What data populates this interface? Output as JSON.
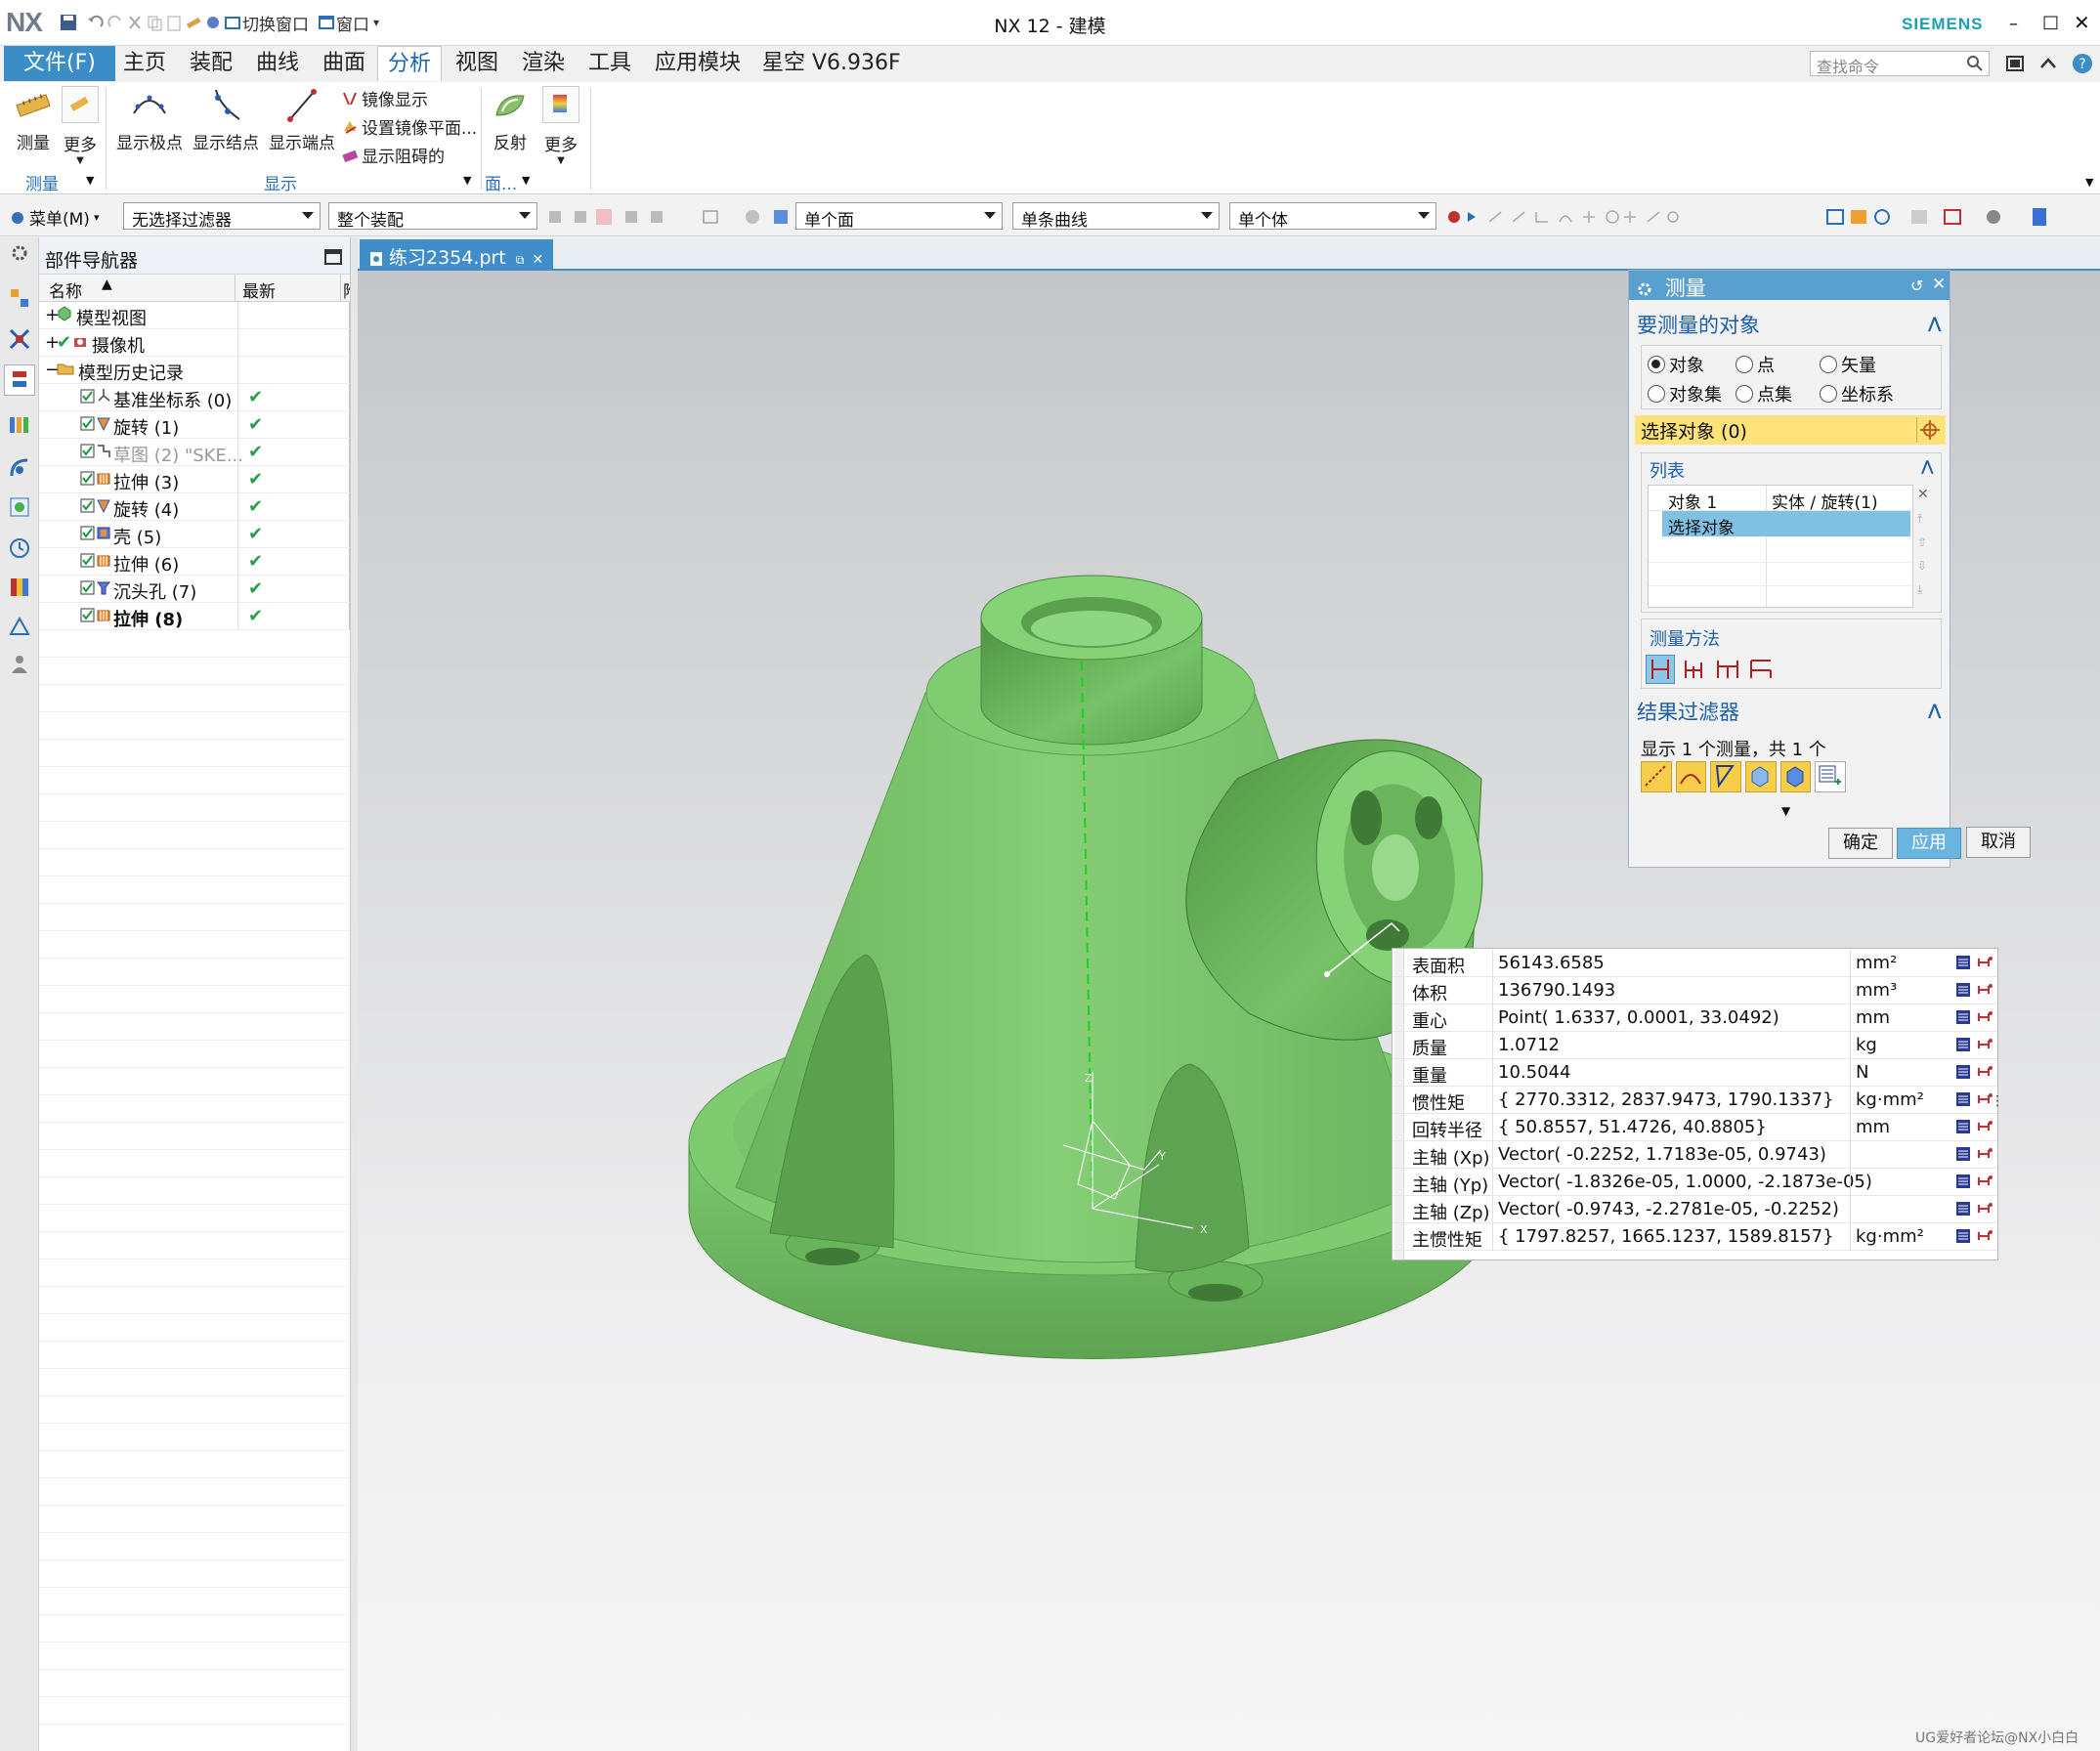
{
  "titlebar": {
    "logo": "NX",
    "title": "NX 12 - 建模",
    "brand": "SIEMENS",
    "switch_window": "切换窗口",
    "window_menu": "窗口"
  },
  "menu": {
    "file": "文件(F)",
    "tabs": [
      "主页",
      "装配",
      "曲线",
      "曲面",
      "分析",
      "视图",
      "渲染",
      "工具",
      "应用模块",
      "星空 V6.936F"
    ],
    "active_tab": "分析",
    "search_placeholder": "查找命令"
  },
  "ribbon": {
    "measure": "测量",
    "more1": "更多",
    "show_poles": "显示极点",
    "show_knots": "显示结点",
    "show_endpoints": "显示端点",
    "mirror_display": "镜像显示",
    "set_mirror_plane": "设置镜像平面...",
    "show_blocked": "显示阻碍的",
    "reflect": "反射",
    "more2": "更多",
    "group_measure": "测量",
    "group_display": "显示",
    "group_face": "面..."
  },
  "selbar": {
    "menu": "菜单(M)",
    "filter": "无选择过滤器",
    "scope": "整个装配",
    "face_rule": "单个面",
    "curve_rule": "单条曲线",
    "body_rule": "单个体"
  },
  "navigator": {
    "title": "部件导航器",
    "col_name": "名称",
    "col_latest": "最新",
    "col_extra": "附",
    "items": [
      {
        "label": "模型视图",
        "ok": ""
      },
      {
        "label": "摄像机",
        "ok": ""
      },
      {
        "label": "模型历史记录",
        "ok": ""
      },
      {
        "label": "基准坐标系 (0)",
        "ok": "✔"
      },
      {
        "label": "旋转 (1)",
        "ok": "✔"
      },
      {
        "label": "草图 (2) \"SKE...",
        "ok": "✔"
      },
      {
        "label": "拉伸 (3)",
        "ok": "✔"
      },
      {
        "label": "旋转 (4)",
        "ok": "✔"
      },
      {
        "label": "壳 (5)",
        "ok": "✔"
      },
      {
        "label": "拉伸 (6)",
        "ok": "✔"
      },
      {
        "label": "沉头孔 (7)",
        "ok": "✔"
      },
      {
        "label": "拉伸 (8)",
        "ok": "✔"
      }
    ]
  },
  "doc_tab": "练习2354.prt",
  "dialog": {
    "title": "测量",
    "sec_objects": "要测量的对象",
    "radios": [
      "对象",
      "点",
      "矢量",
      "对象集",
      "点集",
      "坐标系"
    ],
    "select_object": "选择对象 (0)",
    "list_header": "列表",
    "list_row1_a": "对象 1",
    "list_row1_b": "实体 / 旋转(1)",
    "list_row2": "选择对象",
    "method": "测量方法",
    "sec_filter": "结果过滤器",
    "filter_summary": "显示 1 个测量，共 1 个",
    "ok": "确定",
    "apply": "应用",
    "cancel": "取消"
  },
  "results": [
    {
      "name": "表面积",
      "value": "56143.6585",
      "unit": "mm²"
    },
    {
      "name": "体积",
      "value": "136790.1493",
      "unit": "mm³"
    },
    {
      "name": "重心",
      "value": "Point( 1.6337, 0.0001, 33.0492)",
      "unit": "mm"
    },
    {
      "name": "质量",
      "value": "1.0712",
      "unit": "kg"
    },
    {
      "name": "重量",
      "value": "10.5044",
      "unit": "N"
    },
    {
      "name": "惯性矩",
      "value": "{ 2770.3312, 2837.9473, 1790.1337}",
      "unit": "kg·mm²"
    },
    {
      "name": "回转半径",
      "value": "{ 50.8557, 51.4726, 40.8805}",
      "unit": "mm"
    },
    {
      "name": "主轴 (Xp)",
      "value": "Vector( -0.2252, 1.7183e-05, 0.9743)",
      "unit": ""
    },
    {
      "name": "主轴 (Yp)",
      "value": "Vector( -1.8326e-05, 1.0000, -2.1873e-05)",
      "unit": ""
    },
    {
      "name": "主轴 (Zp)",
      "value": "Vector( -0.9743, -2.2781e-05, -0.2252)",
      "unit": ""
    },
    {
      "name": "主惯性矩",
      "value": "{ 1797.8257, 1665.1237, 1589.8157}",
      "unit": "kg·mm²"
    }
  ],
  "axes": {
    "z": "Z",
    "y": "Y",
    "x": "X"
  },
  "watermark": "UG爱好者论坛@NX小白白",
  "colors": {
    "part": "#7cc86e",
    "accent": "#3a8dc6",
    "highlight": "#ffe27a",
    "check": "#22a045"
  }
}
